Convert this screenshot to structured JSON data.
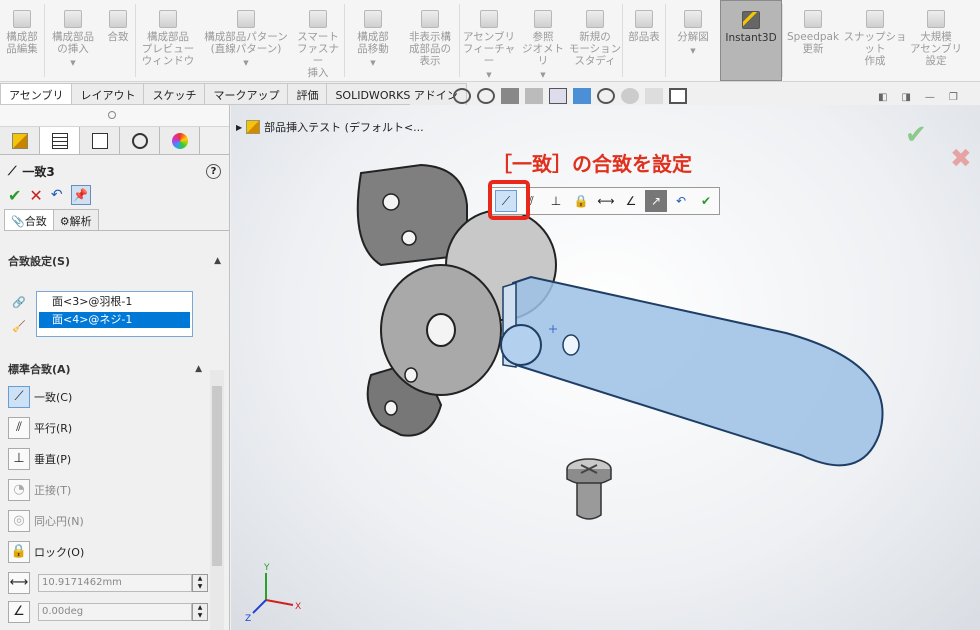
{
  "ribbon": {
    "buttons": [
      {
        "label": "構成部\n品編集",
        "arrow": false
      },
      {
        "label": "構成部品\nの挿入",
        "arrow": true
      },
      {
        "label": "合致",
        "arrow": false
      },
      {
        "label": "構成部品\nプレビュー\nウィンドウ",
        "arrow": false
      },
      {
        "label": "構成部品パターン\n(直線パターン)",
        "arrow": true
      },
      {
        "label": "スマート\nファスナー\n挿入",
        "arrow": false
      },
      {
        "label": "構成部\n品移動",
        "arrow": true
      },
      {
        "label": "非表示構\n成部品の\n表示",
        "arrow": false
      },
      {
        "label": "アセンブリ\nフィーチャー",
        "arrow": true
      },
      {
        "label": "参照\nジオメトリ",
        "arrow": true
      },
      {
        "label": "新規の\nモーション\nスタディ",
        "arrow": false
      },
      {
        "label": "部品表",
        "arrow": false
      },
      {
        "label": "分解図",
        "arrow": true
      },
      {
        "label": "Instant3D",
        "arrow": false,
        "active": true
      },
      {
        "label": "Speedpak\n更新",
        "arrow": false
      },
      {
        "label": "スナップショット\n作成",
        "arrow": false
      },
      {
        "label": "大規模\nアセンブリ\n設定",
        "arrow": false
      }
    ]
  },
  "tabs": [
    "アセンブリ",
    "レイアウト",
    "スケッチ",
    "マークアップ",
    "評価",
    "SOLIDWORKS アドイン"
  ],
  "tree": {
    "label": "部品挿入テスト (デフォルト<..."
  },
  "panel": {
    "title": "一致3",
    "help": "?",
    "subtabs": [
      "合致",
      "解析"
    ],
    "mate_settings": {
      "header": "合致設定(S)",
      "items": [
        "面<3>@羽根-1",
        "面<4>@ネジ-1"
      ]
    },
    "standard": {
      "header": "標準合致(A)",
      "items": [
        {
          "label": "一致(C)",
          "icon": "coincident-icon",
          "enabled": true,
          "selected": true
        },
        {
          "label": "平行(R)",
          "icon": "parallel-icon",
          "enabled": true
        },
        {
          "label": "垂直(P)",
          "icon": "perpendicular-icon",
          "enabled": true
        },
        {
          "label": "正接(T)",
          "icon": "tangent-icon",
          "enabled": false
        },
        {
          "label": "同心円(N)",
          "icon": "concentric-icon",
          "enabled": false
        },
        {
          "label": "ロック(O)",
          "icon": "lock-icon",
          "enabled": true
        }
      ]
    },
    "distance": "10.9171462mm",
    "angle": "0.00deg"
  },
  "callout": "［一致］の合致を設定",
  "axes": {
    "x": "X",
    "y": "Y",
    "z": "Z"
  },
  "colors": {
    "callout": "#e0301e",
    "selection": "#0078d7",
    "part_gray": "#8a8a8a",
    "part_blue": "#9cc0e4"
  }
}
